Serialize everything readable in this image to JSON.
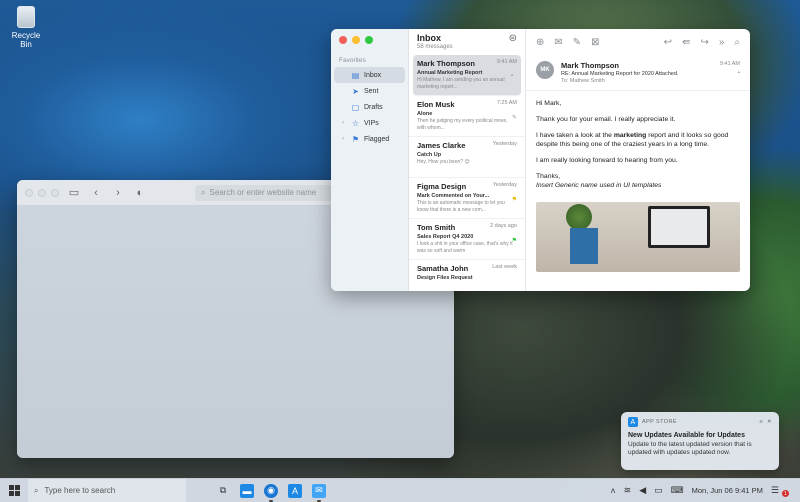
{
  "desktop": {
    "recycle_bin_label": "Recycle Bin"
  },
  "browser": {
    "search_placeholder": "Search or enter website name"
  },
  "mail": {
    "sidebar": {
      "favorites_label": "Favorites",
      "items": [
        {
          "label": "Inbox",
          "icon": "inbox-icon"
        },
        {
          "label": "Sent",
          "icon": "paper-plane-icon"
        },
        {
          "label": "Drafts",
          "icon": "document-icon"
        },
        {
          "label": "VIPs",
          "icon": "star-icon"
        },
        {
          "label": "Flagged",
          "icon": "flag-icon"
        }
      ]
    },
    "list": {
      "title": "Inbox",
      "count": "58 messages",
      "messages": [
        {
          "from": "Mark Thompson",
          "time": "9:41 AM",
          "subject": "Annual Marketing Report",
          "preview": "Hi Mathew, I am sending you an annual marketing report..."
        },
        {
          "from": "Elon Musk",
          "time": "7:25 AM",
          "subject": "Alone",
          "preview": "Then he judging my every political move, with whom..."
        },
        {
          "from": "James Clarke",
          "time": "Yesterday",
          "subject": "Catch Up",
          "preview": "Hey, How you been? 😊"
        },
        {
          "from": "Figma Design",
          "time": "Yesterday",
          "subject": "Mark Commented on Your...",
          "preview": "This is an automatic message to let you know that there is a new com..."
        },
        {
          "from": "Tom Smith",
          "time": "2 days ago",
          "subject": "Sales Report Q4 2020",
          "preview": "I look a shit in your office case, that's why it was so soft and warm"
        },
        {
          "from": "Samatha John",
          "time": "Last week",
          "subject": "Design Files Request",
          "preview": ""
        }
      ]
    },
    "reader": {
      "avatar_initials": "MK",
      "from": "Mark Thompson",
      "time": "9:41 AM",
      "subject": "RE: Annual Marketing Report for 2020 Attached.",
      "to_label": "To:",
      "to": "Mathew Smith",
      "greeting": "Hi Mark,",
      "p1": "Thank you for your email. I really appreciate it.",
      "p2_a": "I have taken a look at the ",
      "p2_b": "marketing",
      "p2_c": " report and it looks so good despite this being one of the craziest years in a long time.",
      "p3": "I am really looking forward to hearing from you.",
      "signoff": "Thanks,",
      "signature": "Insert Generic name used in UI templates"
    }
  },
  "notification": {
    "app": "APP STORE",
    "title": "New Updates Available for Updates",
    "text": "Update to the latest updated version that is updated with updates updated now."
  },
  "taskbar": {
    "search_placeholder": "Type here to search",
    "datetime": "Mon, Jun 06  9:41 PM",
    "notification_count": "1"
  },
  "colors": {
    "accent": "#3a7bd5",
    "close": "#f25f58",
    "minimize": "#fbbe2e",
    "zoom": "#2fc840"
  }
}
